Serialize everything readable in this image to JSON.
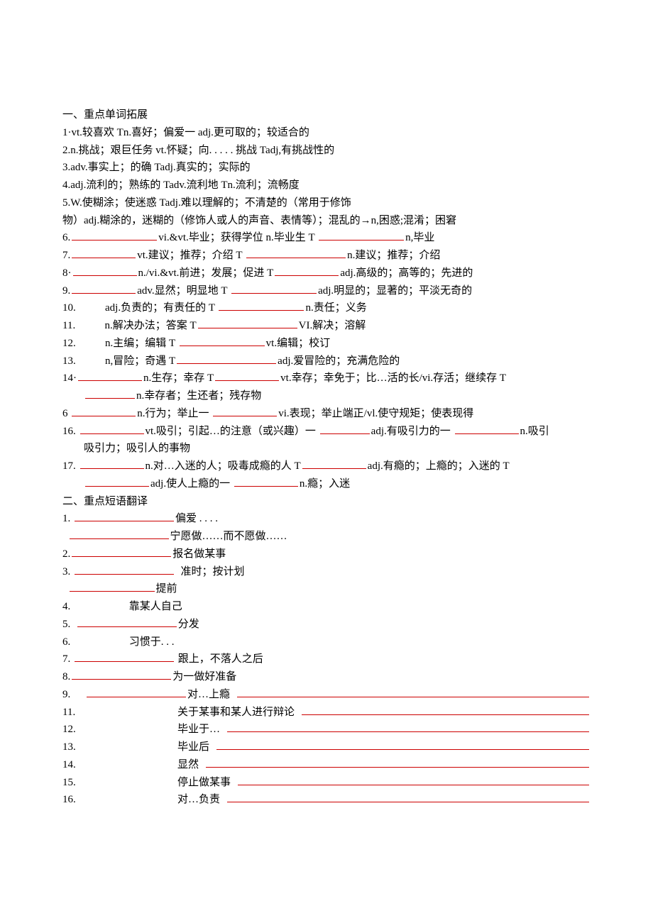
{
  "section1": {
    "heading": "一、重点单词拓展",
    "items": [
      "1·vt.较喜欢 Tn.喜好；偏爱一 adj.更可取的；较适合的",
      "2.n.挑战；艰巨任务 vt.怀疑；向. . . . . 挑战 Tadj,有挑战性的",
      " 3.adv.事实上；的确 Tadj.真实的；实际的",
      " 4.adj.流利的；熟练的 Tadv.流利地 Tn.流利；流畅度",
      " 5.W.使糊涂；使迷惑 Tadj.难以理解的；不清楚的（常用于修饰",
      "物）adj.糊涂的，迷糊的（修饰人或人的声音、表情等）；混乱的→n,困惑;混淆；困窘"
    ],
    "blanks": [
      {
        "num": "6.",
        "mid": "vi.&vt.毕业；获得学位 n.毕业生 T",
        "tail": "n,毕业"
      },
      {
        "num": "7.",
        "mid": "vt.建议；推荐；介绍 T",
        "tail": "n.建议；推荐；介绍"
      },
      {
        "num": "8·",
        "mid": "n./vi.&vt.前进；发展；促进 T",
        "tail": "adj.高级的；高等的；先进的"
      },
      {
        "num": "9.",
        "mid": "adv.显然；明显地 T",
        "tail": "adj.明显的；显著的；平淡无奇的"
      },
      {
        "num": "10.",
        "mid": "adj.负责的；有责任的 T",
        "tail": "n.责任；义务"
      },
      {
        "num": "11.",
        "mid": "n.解决办法；答案 T",
        "tail": "VI.解决；溶解"
      },
      {
        "num": "12.",
        "mid": "n.主编；编辑 T",
        "tail": "vt.编辑；校订"
      },
      {
        "num": "13.",
        "mid": "n,冒险；奇遇 T",
        "tail": "adj.爱冒险的；充满危险的"
      },
      {
        "num": "14·",
        "mid": "n.生存；幸存 T",
        "tail": "vt.幸存；幸免于；比…活的长/vi.存活；继续存 T"
      },
      {
        "cont": true,
        "mid": "n.幸存者；生还者；残存物"
      },
      {
        "num": "6",
        "mid": "n.行为；举止一",
        "tail": "vi.表现；举止端正/vl.使守规矩；使表现得"
      },
      {
        "num": "16.",
        "mid": "vt.吸引；引起…的注意（或兴趣）一",
        "tail1": "adj.有吸引力的一",
        "tail2": "n.吸引"
      },
      {
        "cont2": true,
        "mid": "吸引力；吸引人的事物"
      },
      {
        "num": "17.",
        "mid": "n.对…入迷的人；吸毒成瘾的人 T",
        "tail": "adj.有瘾的；上瘾的；入迷的 T"
      },
      {
        "cont": true,
        "pre": "",
        "mid": "adj.使人上瘾的一",
        "tail": "n.瘾；入迷"
      }
    ]
  },
  "section2": {
    "heading": "二、重点短语翻译",
    "items": [
      {
        "num": "1.",
        "fill": "xlong",
        "text": "偏爱  . . . ."
      },
      {
        "num": "",
        "fill": "xlong",
        "text": "宁愿做……而不愿做……",
        "indent": true
      },
      {
        "num": "2.",
        "fill": "xlong",
        "text": "报名做某事"
      },
      {
        "num": "3.",
        "fill": "xlong",
        "text": "准时；按计划"
      },
      {
        "num": "",
        "fill": "long",
        "text": "提前",
        "indent": true
      },
      {
        "num": "4.",
        "fill": "xlong",
        "text": "靠某人自己"
      },
      {
        "num": "5.",
        "fill": "xlong",
        "text": "分发"
      },
      {
        "num": "6.",
        "fill": "xlong",
        "text": "习惯于. . ."
      },
      {
        "num": "7.",
        "fill": "xlong",
        "text": "跟上，不落人之后"
      },
      {
        "num": "8.",
        "fill": "xlong",
        "text": "为一做好准备"
      },
      {
        "num": "9.",
        "fill": "xlong",
        "text": "对…上瘾",
        "leader": true
      }
    ],
    "leaders": [
      {
        "num": "11.",
        "text": "关于某事和某人进行辩论"
      },
      {
        "num": "12.",
        "text": "毕业于…"
      },
      {
        "num": "13.",
        "text": "毕业后"
      },
      {
        "num": "14.",
        "text": "显然"
      },
      {
        "num": "15.",
        "text": "停止做某事"
      },
      {
        "num": "16.",
        "text": "对…负责"
      }
    ]
  }
}
